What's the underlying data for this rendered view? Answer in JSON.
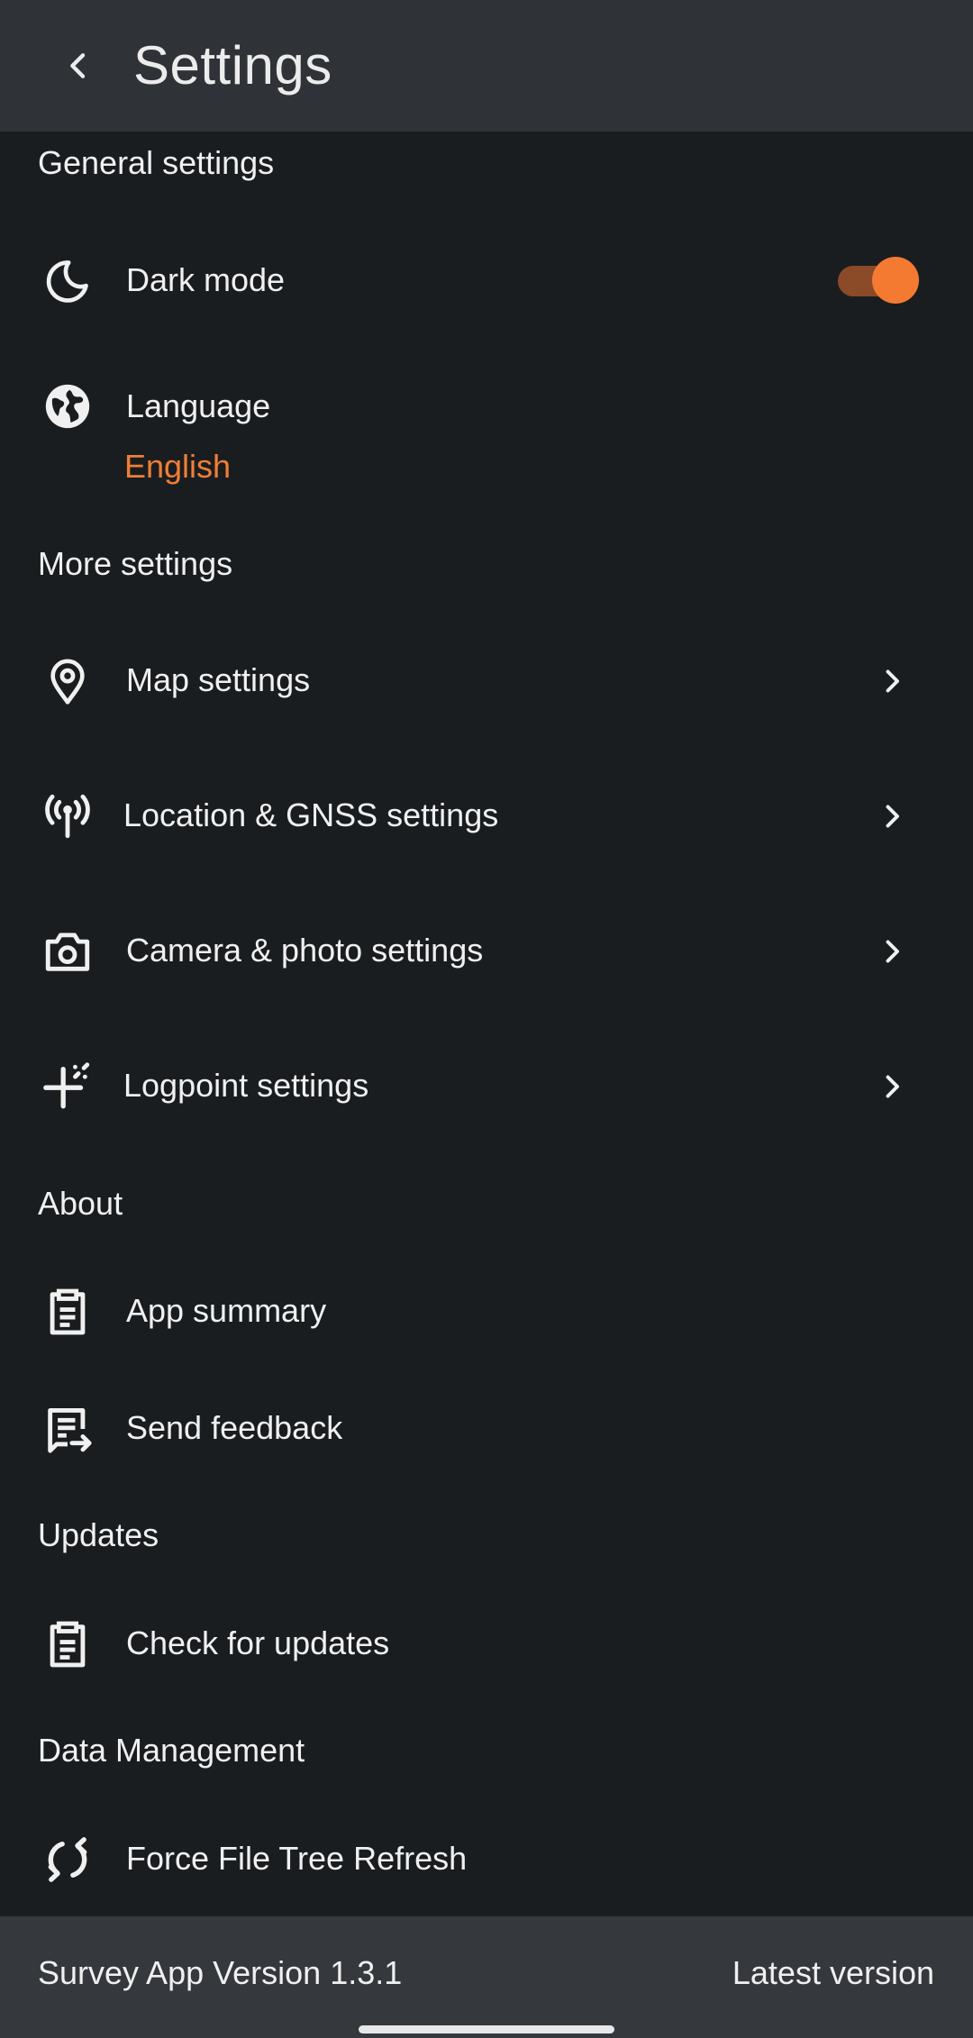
{
  "header": {
    "title": "Settings",
    "back_icon": "chevron-left-icon"
  },
  "sections": {
    "general": {
      "label": "General settings",
      "dark_mode": {
        "label": "Dark mode",
        "icon": "moon-icon",
        "enabled": true
      },
      "language": {
        "label": "Language",
        "value": "English",
        "icon": "globe-icon"
      }
    },
    "more": {
      "label": "More settings",
      "items": [
        {
          "label": "Map settings",
          "icon": "map-pin-icon"
        },
        {
          "label": "Location & GNSS settings",
          "icon": "antenna-icon"
        },
        {
          "label": "Camera & photo settings",
          "icon": "camera-icon"
        },
        {
          "label": "Logpoint settings",
          "icon": "crosshair-sparkle-icon"
        }
      ]
    },
    "about": {
      "label": "About",
      "items": [
        {
          "label": "App summary",
          "icon": "clipboard-icon"
        },
        {
          "label": "Send feedback",
          "icon": "feedback-icon"
        }
      ]
    },
    "updates": {
      "label": "Updates",
      "items": [
        {
          "label": "Check for updates",
          "icon": "clipboard-icon"
        }
      ]
    },
    "data_management": {
      "label": "Data Management",
      "items": [
        {
          "label": "Force File Tree Refresh",
          "icon": "refresh-icon"
        }
      ]
    }
  },
  "footer": {
    "version": "Survey App Version 1.3.1",
    "status": "Latest version"
  },
  "colors": {
    "accent": "#f47a32",
    "toggle_track": "#8b4a28",
    "background": "#1a1d20",
    "topbar": "#2f3236",
    "footer": "#35383c"
  }
}
